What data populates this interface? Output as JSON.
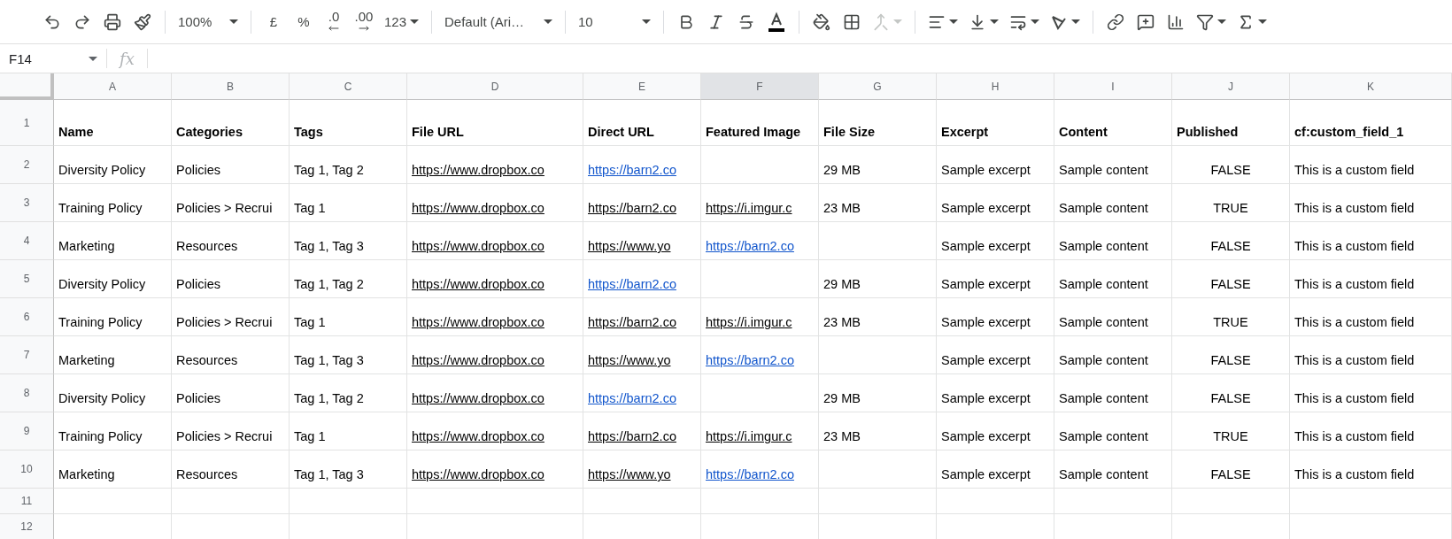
{
  "toolbar": {
    "zoom": "100%",
    "currency": "£",
    "percent": "%",
    "decrease_decimal": ".0",
    "increase_decimal": ".00",
    "number_format": "123",
    "font": "Default (Ari…",
    "font_size": "10",
    "merge_cells": {
      "disabled": true
    }
  },
  "formula_bar": {
    "name_box": "F14",
    "fx_label": "fx"
  },
  "column_headers": [
    {
      "label": "A",
      "selected": false
    },
    {
      "label": "B",
      "selected": false
    },
    {
      "label": "C",
      "selected": false
    },
    {
      "label": "D",
      "selected": false
    },
    {
      "label": "E",
      "selected": false
    },
    {
      "label": "F",
      "selected": true
    },
    {
      "label": "G",
      "selected": false
    },
    {
      "label": "H",
      "selected": false
    },
    {
      "label": "I",
      "selected": false
    },
    {
      "label": "J",
      "selected": false
    },
    {
      "label": "K",
      "selected": false
    }
  ],
  "rows": [
    {
      "number": "1",
      "cells": [
        {
          "text": "Name",
          "kind": "header"
        },
        {
          "text": "Categories",
          "kind": "header"
        },
        {
          "text": "Tags",
          "kind": "header"
        },
        {
          "text": "File URL",
          "kind": "header"
        },
        {
          "text": "Direct URL",
          "kind": "header"
        },
        {
          "text": "Featured Image",
          "kind": "header"
        },
        {
          "text": "File Size",
          "kind": "header"
        },
        {
          "text": "Excerpt",
          "kind": "header"
        },
        {
          "text": "Content",
          "kind": "header"
        },
        {
          "text": "Published",
          "kind": "header"
        },
        {
          "text": "cf:custom_field_1",
          "kind": "header"
        }
      ]
    },
    {
      "number": "2",
      "cells": [
        {
          "text": "Diversity Policy",
          "kind": "text"
        },
        {
          "text": "Policies",
          "kind": "text"
        },
        {
          "text": "Tag 1, Tag 2",
          "kind": "text"
        },
        {
          "text": "https://www.dropbox.co",
          "kind": "url"
        },
        {
          "text": "https://barn2.co",
          "kind": "link"
        },
        {
          "kind": "empty"
        },
        {
          "text": "29 MB",
          "kind": "text"
        },
        {
          "text": "Sample excerpt",
          "kind": "text"
        },
        {
          "text": "Sample content",
          "kind": "text"
        },
        {
          "text": "FALSE",
          "kind": "boolean"
        },
        {
          "text": "This is a custom field",
          "kind": "text"
        }
      ]
    },
    {
      "number": "3",
      "cells": [
        {
          "text": "Training Policy",
          "kind": "text"
        },
        {
          "text": "Policies > Recrui",
          "kind": "text"
        },
        {
          "text": "Tag 1",
          "kind": "text"
        },
        {
          "text": "https://www.dropbox.co",
          "kind": "url"
        },
        {
          "text": "https://barn2.co",
          "kind": "url"
        },
        {
          "text": "https://i.imgur.c",
          "kind": "url"
        },
        {
          "text": "23 MB",
          "kind": "text"
        },
        {
          "text": "Sample excerpt",
          "kind": "text"
        },
        {
          "text": "Sample content",
          "kind": "text"
        },
        {
          "text": "TRUE",
          "kind": "boolean"
        },
        {
          "text": "This is a custom field",
          "kind": "text"
        }
      ]
    },
    {
      "number": "4",
      "cells": [
        {
          "text": "Marketing",
          "kind": "text"
        },
        {
          "text": "Resources",
          "kind": "text"
        },
        {
          "text": "Tag 1, Tag 3",
          "kind": "text"
        },
        {
          "text": "https://www.dropbox.co",
          "kind": "url"
        },
        {
          "text": "https://www.yo",
          "kind": "url"
        },
        {
          "text": "https://barn2.co",
          "kind": "link"
        },
        {
          "kind": "empty"
        },
        {
          "text": "Sample excerpt",
          "kind": "text"
        },
        {
          "text": "Sample content",
          "kind": "text"
        },
        {
          "text": "FALSE",
          "kind": "boolean"
        },
        {
          "text": "This is a custom field",
          "kind": "text"
        }
      ]
    },
    {
      "number": "5",
      "cells": [
        {
          "text": "Diversity Policy",
          "kind": "text"
        },
        {
          "text": "Policies",
          "kind": "text"
        },
        {
          "text": "Tag 1, Tag 2",
          "kind": "text"
        },
        {
          "text": "https://www.dropbox.co",
          "kind": "url"
        },
        {
          "text": "https://barn2.co",
          "kind": "link"
        },
        {
          "kind": "empty"
        },
        {
          "text": "29 MB",
          "kind": "text"
        },
        {
          "text": "Sample excerpt",
          "kind": "text"
        },
        {
          "text": "Sample content",
          "kind": "text"
        },
        {
          "text": "FALSE",
          "kind": "boolean"
        },
        {
          "text": "This is a custom field",
          "kind": "text"
        }
      ]
    },
    {
      "number": "6",
      "cells": [
        {
          "text": "Training Policy",
          "kind": "text"
        },
        {
          "text": "Policies > Recrui",
          "kind": "text"
        },
        {
          "text": "Tag 1",
          "kind": "text"
        },
        {
          "text": "https://www.dropbox.co",
          "kind": "url"
        },
        {
          "text": "https://barn2.co",
          "kind": "url"
        },
        {
          "text": "https://i.imgur.c",
          "kind": "url"
        },
        {
          "text": "23 MB",
          "kind": "text"
        },
        {
          "text": "Sample excerpt",
          "kind": "text"
        },
        {
          "text": "Sample content",
          "kind": "text"
        },
        {
          "text": "TRUE",
          "kind": "boolean"
        },
        {
          "text": "This is a custom field",
          "kind": "text"
        }
      ]
    },
    {
      "number": "7",
      "cells": [
        {
          "text": "Marketing",
          "kind": "text"
        },
        {
          "text": "Resources",
          "kind": "text"
        },
        {
          "text": "Tag 1, Tag 3",
          "kind": "text"
        },
        {
          "text": "https://www.dropbox.co",
          "kind": "url"
        },
        {
          "text": "https://www.yo",
          "kind": "url"
        },
        {
          "text": "https://barn2.co",
          "kind": "link"
        },
        {
          "kind": "empty"
        },
        {
          "text": "Sample excerpt",
          "kind": "text"
        },
        {
          "text": "Sample content",
          "kind": "text"
        },
        {
          "text": "FALSE",
          "kind": "boolean"
        },
        {
          "text": "This is a custom field",
          "kind": "text"
        }
      ]
    },
    {
      "number": "8",
      "cells": [
        {
          "text": "Diversity Policy",
          "kind": "text"
        },
        {
          "text": "Policies",
          "kind": "text"
        },
        {
          "text": "Tag 1, Tag 2",
          "kind": "text"
        },
        {
          "text": "https://www.dropbox.co",
          "kind": "url"
        },
        {
          "text": "https://barn2.co",
          "kind": "link"
        },
        {
          "kind": "empty"
        },
        {
          "text": "29 MB",
          "kind": "text"
        },
        {
          "text": "Sample excerpt",
          "kind": "text"
        },
        {
          "text": "Sample content",
          "kind": "text"
        },
        {
          "text": "FALSE",
          "kind": "boolean"
        },
        {
          "text": "This is a custom field",
          "kind": "text"
        }
      ]
    },
    {
      "number": "9",
      "cells": [
        {
          "text": "Training Policy",
          "kind": "text"
        },
        {
          "text": "Policies > Recrui",
          "kind": "text"
        },
        {
          "text": "Tag 1",
          "kind": "text"
        },
        {
          "text": "https://www.dropbox.co",
          "kind": "url"
        },
        {
          "text": "https://barn2.co",
          "kind": "url"
        },
        {
          "text": "https://i.imgur.c",
          "kind": "url"
        },
        {
          "text": "23 MB",
          "kind": "text"
        },
        {
          "text": "Sample excerpt",
          "kind": "text"
        },
        {
          "text": "Sample content",
          "kind": "text"
        },
        {
          "text": "TRUE",
          "kind": "boolean"
        },
        {
          "text": "This is a custom field",
          "kind": "text"
        }
      ]
    },
    {
      "number": "10",
      "cells": [
        {
          "text": "Marketing",
          "kind": "text"
        },
        {
          "text": "Resources",
          "kind": "text"
        },
        {
          "text": "Tag 1, Tag 3",
          "kind": "text"
        },
        {
          "text": "https://www.dropbox.co",
          "kind": "url"
        },
        {
          "text": "https://www.yo",
          "kind": "url"
        },
        {
          "text": "https://barn2.co",
          "kind": "link"
        },
        {
          "kind": "empty"
        },
        {
          "text": "Sample excerpt",
          "kind": "text"
        },
        {
          "text": "Sample content",
          "kind": "text"
        },
        {
          "text": "FALSE",
          "kind": "boolean"
        },
        {
          "text": "This is a custom field",
          "kind": "text"
        }
      ]
    },
    {
      "number": "11"
    },
    {
      "number": "12"
    }
  ]
}
